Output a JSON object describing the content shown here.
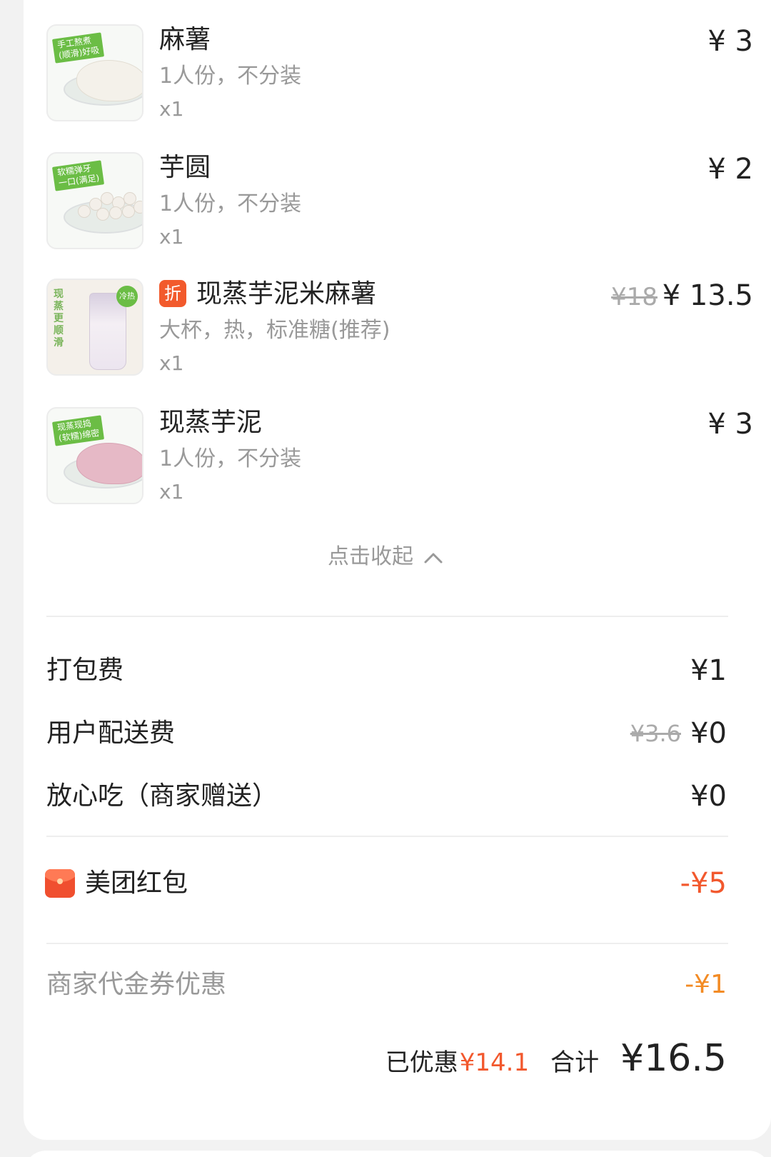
{
  "items": [
    {
      "name": "麻薯",
      "spec": "1人份，不分装",
      "qty": "x1",
      "price": "¥ 3",
      "thumb_tag": "手工熬煮\n(顺滑)好吸"
    },
    {
      "name": "芋圆",
      "spec": "1人份，不分装",
      "qty": "x1",
      "price": "¥ 2",
      "thumb_tag": "软糯弹牙\n一口(满足)"
    },
    {
      "name": "现蒸芋泥米麻薯",
      "badge": "折",
      "spec": "大杯，热，标准糖(推荐)",
      "qty": "x1",
      "old_price": "¥18",
      "price": "¥ 13.5",
      "thumb_side": "现蒸更顺滑",
      "thumb_hot": "冷热"
    },
    {
      "name": "现蒸芋泥",
      "spec": "1人份，不分装",
      "qty": "x1",
      "price": "¥ 3",
      "thumb_tag": "现蒸现捣\n(软糯)绵密"
    }
  ],
  "collapse_label": "点击收起",
  "fees": {
    "packing_label": "打包费",
    "packing_value": "¥1",
    "delivery_label": "用户配送费",
    "delivery_old": "¥3.6",
    "delivery_value": "¥0",
    "safe_label": "放心吃（商家赠送）",
    "safe_value": "¥0"
  },
  "discounts": {
    "hongbao_label": "美团红包",
    "hongbao_value": "-¥5",
    "voucher_label": "商家代金券优惠",
    "voucher_value": "-¥1"
  },
  "total": {
    "saved_label": "已优惠",
    "saved_value": "¥14.1",
    "sum_label": "合计",
    "sum_value": "¥16.5"
  },
  "colors": {
    "accent_red": "#f2582d",
    "accent_orange": "#f38b24",
    "tag_green": "#6bbd45"
  }
}
